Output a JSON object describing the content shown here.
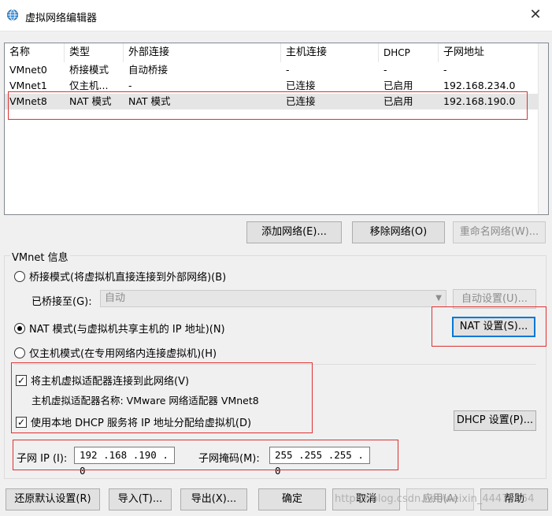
{
  "window": {
    "title": "虚拟网络编辑器",
    "close_glyph": "✕"
  },
  "columns": [
    "名称",
    "类型",
    "外部连接",
    "主机连接",
    "DHCP",
    "子网地址"
  ],
  "networks": [
    {
      "name": "VMnet0",
      "type": "桥接模式",
      "external": "自动桥接",
      "host": "-",
      "dhcp": "-",
      "subnet": "-"
    },
    {
      "name": "VMnet1",
      "type": "仅主机...",
      "external": "-",
      "host": "已连接",
      "dhcp": "已启用",
      "subnet": "192.168.234.0"
    },
    {
      "name": "VMnet8",
      "type": "NAT 模式",
      "external": "NAT 模式",
      "host": "已连接",
      "dhcp": "已启用",
      "subnet": "192.168.190.0"
    }
  ],
  "list_buttons": {
    "add": "添加网络(E)...",
    "remove": "移除网络(O)",
    "rename": "重命名网络(W)..."
  },
  "vmnet_info": {
    "group_title": "VMnet 信息",
    "bridge_radio": "桥接模式(将虚拟机直接连接到外部网络)(B)",
    "bridged_to_label": "已桥接至(G):",
    "bridged_to_value": "自动",
    "auto_settings": "自动设置(U)...",
    "nat_radio": "NAT 模式(与虚拟机共享主机的 IP 地址)(N)",
    "nat_settings": "NAT 设置(S)...",
    "hostonly_radio": "仅主机模式(在专用网络内连接虚拟机)(H)",
    "connect_adapter_check": "将主机虚拟适配器连接到此网络(V)",
    "adapter_name_label": "主机虚拟适配器名称: VMware 网络适配器 VMnet8",
    "dhcp_check": "使用本地 DHCP 服务将 IP 地址分配给虚拟机(D)",
    "dhcp_settings": "DHCP 设置(P)...",
    "subnet_ip_label": "子网 IP (I):",
    "subnet_ip_value": "192 .168 .190 . 0",
    "subnet_mask_label": "子网掩码(M):",
    "subnet_mask_value": "255 .255 .255 . 0",
    "check_glyph": "✓"
  },
  "bottom_buttons": {
    "restore": "还原默认设置(R)",
    "import": "导入(T)...",
    "export": "导出(X)...",
    "ok": "确定",
    "cancel": "取消",
    "apply": "应用(A)",
    "help": "帮助"
  },
  "watermark": "https://blog.csdn.net/weixin_44475054",
  "colors": {
    "highlight_border": "#e03030",
    "focus_blue": "#0078d7",
    "selected_row": "#e5e5e5"
  }
}
